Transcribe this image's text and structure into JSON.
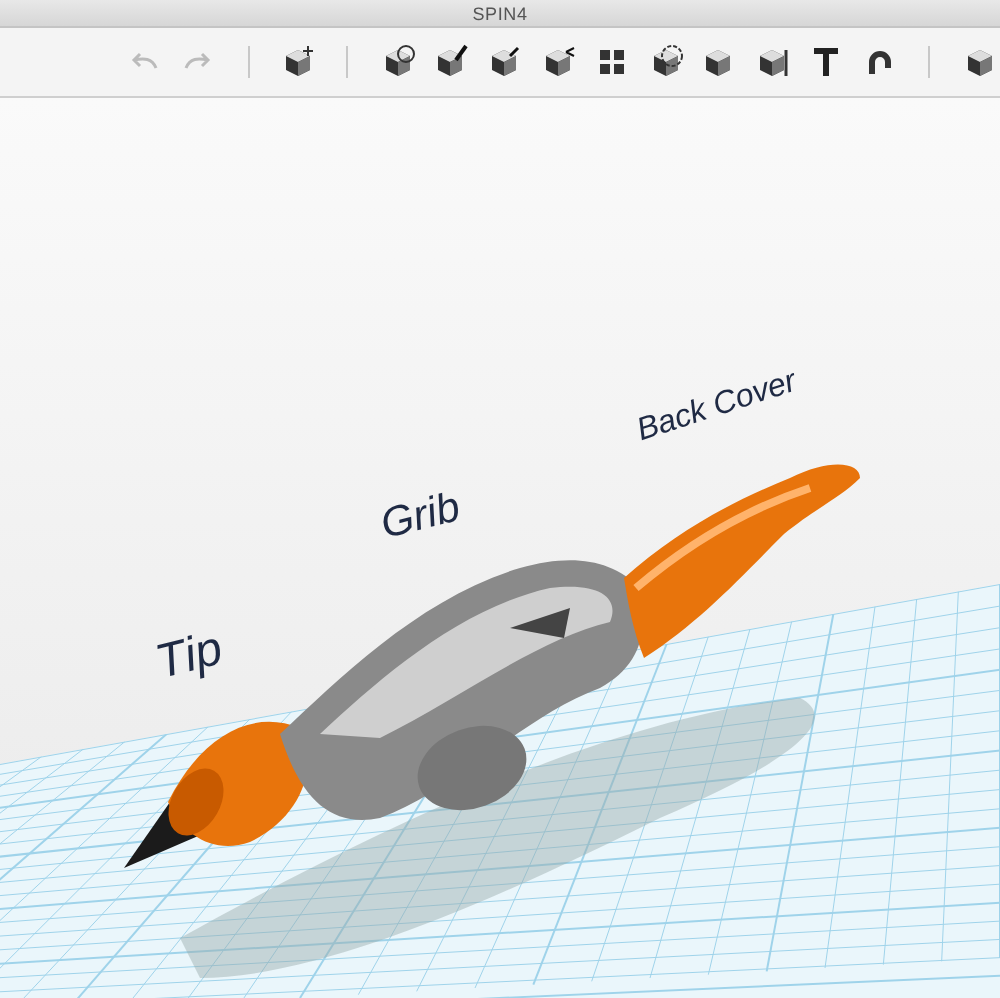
{
  "window": {
    "title": "SPIN4"
  },
  "viewport": {
    "labels": [
      {
        "text": "Tip"
      },
      {
        "text": "Grib"
      },
      {
        "text": "Back Cover"
      }
    ]
  }
}
